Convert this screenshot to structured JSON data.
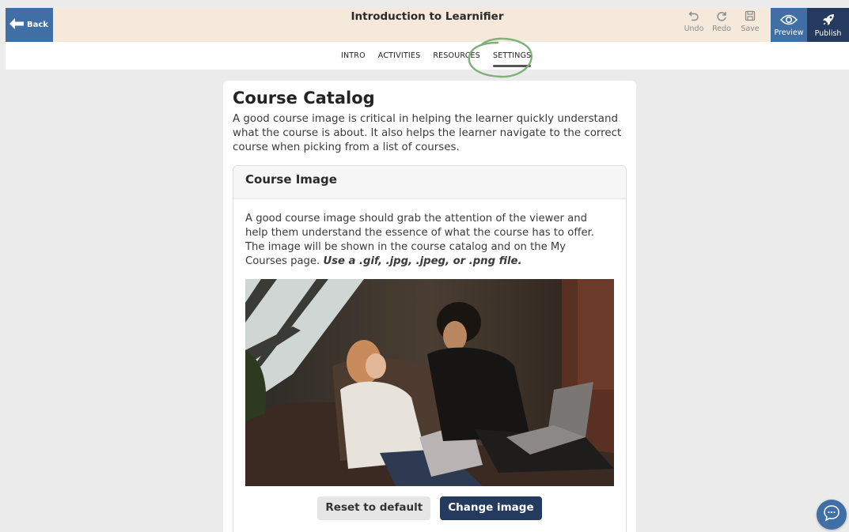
{
  "header": {
    "back_label": "Back",
    "title": "Introduction to Learnifier",
    "undo_label": "Undo",
    "redo_label": "Redo",
    "save_label": "Save",
    "preview_label": "Preview",
    "publish_label": "Publish"
  },
  "tabs": [
    {
      "label": "INTRO"
    },
    {
      "label": "ACTIVITIES"
    },
    {
      "label": "RESOURCES"
    },
    {
      "label": "SETTINGS",
      "active": true
    }
  ],
  "catalog": {
    "title": "Course Catalog",
    "description": "A good course image is critical in helping the learner quickly understand what the course is about. It also helps the learner navigate to the correct course when picking from a list of courses."
  },
  "course_image": {
    "heading": "Course Image",
    "description": "A good course image should grab the attention of the viewer and help them understand the essence of what the course has to offer. The image will be shown in the course catalog and on the My Courses page.",
    "formats_note": "Use a .gif, .jpg, .jpeg, or .png file.",
    "reset_label": "Reset to default",
    "change_label": "Change image"
  },
  "colors": {
    "header_bg": "#f5e9dc",
    "accent_blue": "#3f6fa4",
    "dark_navy": "#243a5e",
    "annotation_green": "#7fb07a"
  },
  "icons": {
    "back": "arrow-left-icon",
    "undo": "undo-icon",
    "redo": "redo-icon",
    "save": "save-icon",
    "preview": "eye-icon",
    "publish": "rocket-icon",
    "chat": "chat-bubble-icon"
  }
}
